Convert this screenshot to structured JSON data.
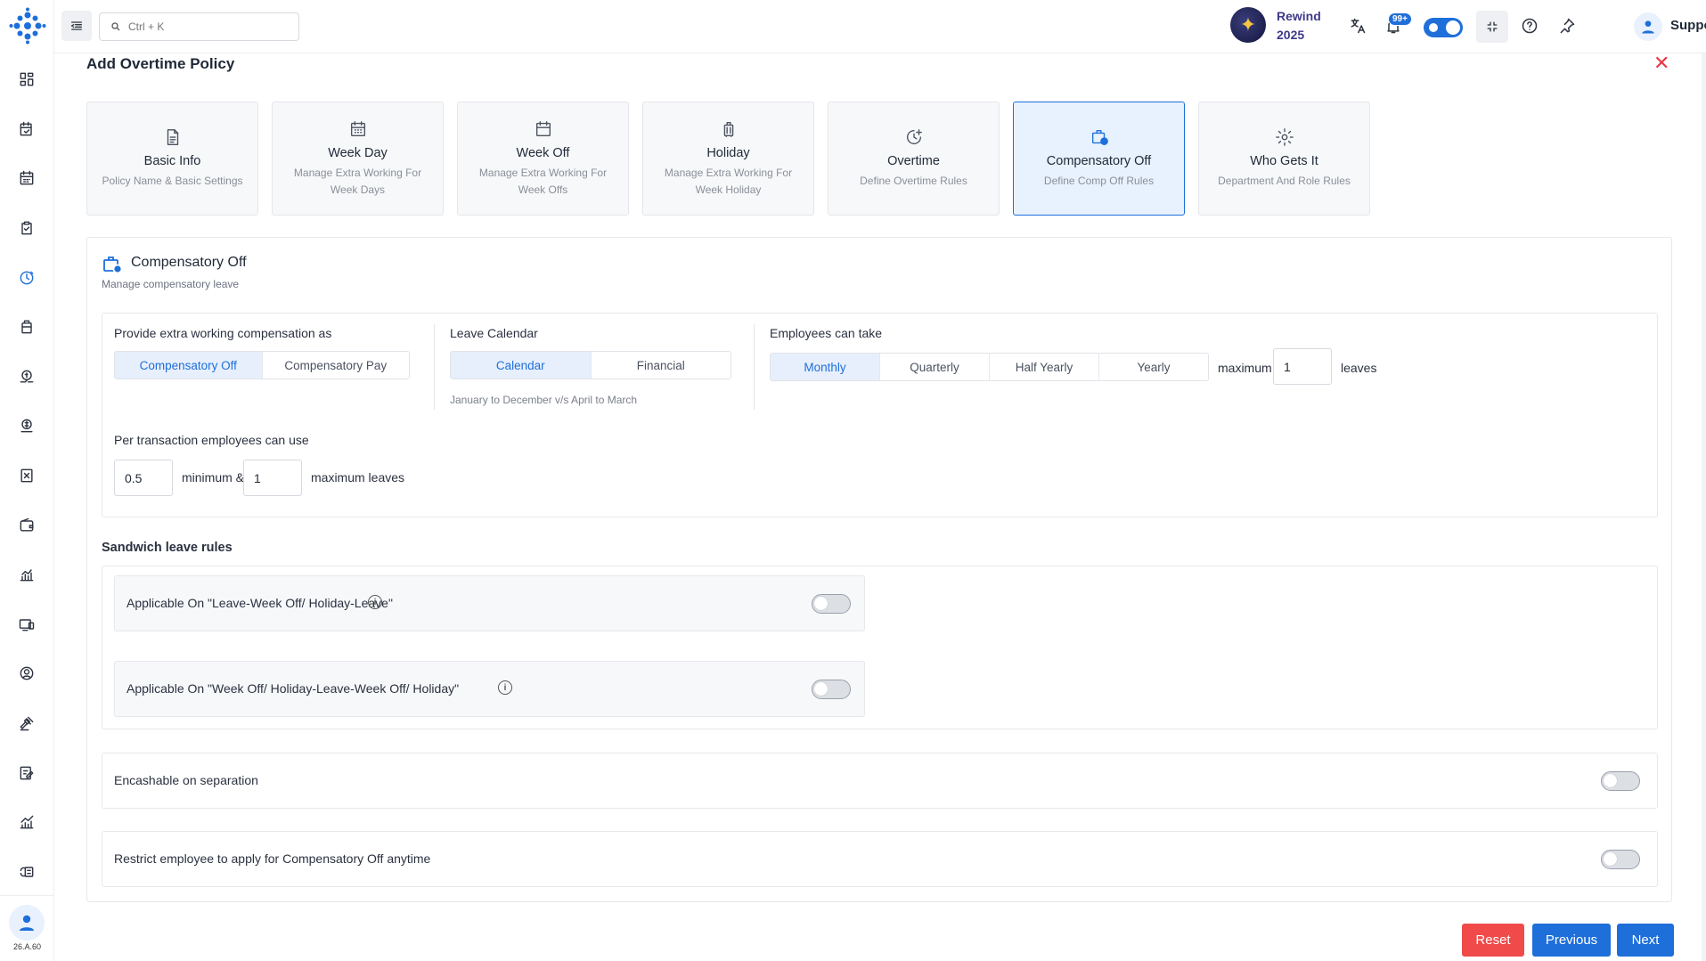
{
  "topbar": {
    "search_placeholder": "Ctrl + K",
    "rewind_line1": "Rewind",
    "rewind_line2": "2025",
    "notification_count": "99+",
    "support_label": "Support"
  },
  "sidebar": {
    "version": "26.A.60",
    "icons": [
      "dashboard-icon",
      "tasks-icon",
      "calendar-icon",
      "attendance-icon",
      "clock-icon",
      "briefcase-icon",
      "payroll-icon",
      "expense-icon",
      "document-icon",
      "wallet-icon",
      "analytics-icon",
      "devices-icon",
      "profile-icon",
      "legal-icon",
      "forms-icon",
      "growth-icon",
      "settings-icon"
    ]
  },
  "page": {
    "title": "Add Overtime Policy"
  },
  "steps": [
    {
      "title": "Basic Info",
      "sub": "Policy Name & Basic Settings"
    },
    {
      "title": "Week Day",
      "sub": "Manage Extra Working For Week Days"
    },
    {
      "title": "Week Off",
      "sub": "Manage Extra Working For Week Offs"
    },
    {
      "title": "Holiday",
      "sub": "Manage Extra Working For Week Holiday"
    },
    {
      "title": "Overtime",
      "sub": "Define Overtime Rules"
    },
    {
      "title": "Compensatory Off",
      "sub": "Define Comp Off Rules"
    },
    {
      "title": "Who Gets It",
      "sub": "Department And Role Rules"
    }
  ],
  "section": {
    "title": "Compensatory Off",
    "subtitle": "Manage compensatory leave"
  },
  "compensation": {
    "label": "Provide extra working compensation as",
    "options": [
      "Compensatory Off",
      "Compensatory Pay"
    ],
    "selected": "Compensatory Off"
  },
  "leave_calendar": {
    "label": "Leave Calendar",
    "options": [
      "Calendar",
      "Financial"
    ],
    "selected": "Calendar",
    "hint": "January to December v/s April to March"
  },
  "employees_can_take": {
    "label": "Employees can take",
    "options": [
      "Monthly",
      "Quarterly",
      "Half Yearly",
      "Yearly"
    ],
    "selected": "Monthly",
    "maximum_label": "maximum",
    "maximum_value": "1",
    "leaves_label": "leaves"
  },
  "per_transaction": {
    "label": "Per transaction employees can use",
    "min_value": "0.5",
    "min_label": "minimum &",
    "max_value": "1",
    "max_label": "maximum leaves"
  },
  "sandwich": {
    "title": "Sandwich leave rules",
    "rule1": "Applicable On \"Leave-Week Off/ Holiday-Leave\"",
    "rule2": "Applicable On \"Week Off/ Holiday-Leave-Week Off/ Holiday\"",
    "rule1_on": false,
    "rule2_on": false
  },
  "options": {
    "encashable": "Encashable on separation",
    "encashable_on": false,
    "restrict": "Restrict employee to apply for Compensatory Off anytime",
    "restrict_on": false
  },
  "footer": {
    "reset": "Reset",
    "previous": "Previous",
    "next": "Next"
  },
  "colors": {
    "primary": "#1e6fd9",
    "danger": "#f04a4a",
    "active_bg": "#e7effc"
  }
}
